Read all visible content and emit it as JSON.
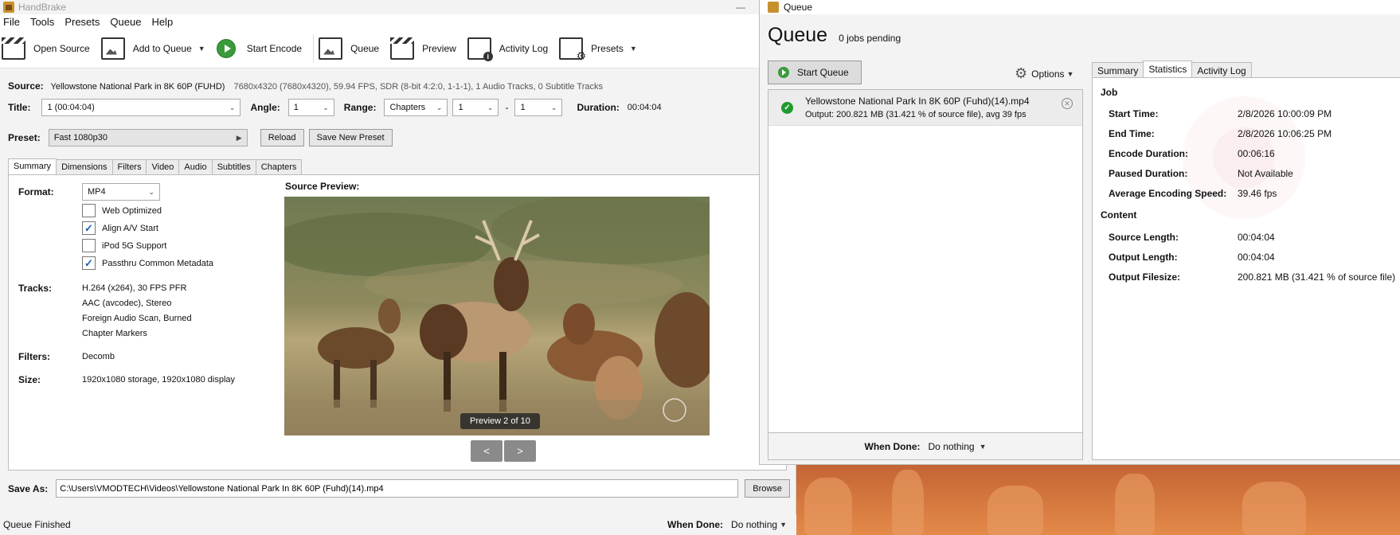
{
  "main": {
    "title": "HandBrake",
    "menu": [
      "File",
      "Tools",
      "Presets",
      "Queue",
      "Help"
    ],
    "toolbar": {
      "open_source": "Open Source",
      "add_to_queue": "Add to Queue",
      "start_encode": "Start Encode",
      "queue": "Queue",
      "preview": "Preview",
      "activity_log": "Activity Log",
      "presets": "Presets"
    },
    "source": {
      "label": "Source:",
      "name": "Yellowstone National Park in 8K 60P (FUHD)",
      "meta": "7680x4320 (7680x4320), 59.94 FPS, SDR (8-bit 4:2:0, 1-1-1), 1 Audio Tracks, 0 Subtitle Tracks"
    },
    "title_row": {
      "title_label": "Title:",
      "title_value": "1 (00:04:04)",
      "angle_label": "Angle:",
      "angle_value": "1",
      "range_label": "Range:",
      "range_type": "Chapters",
      "range_start": "1",
      "range_dash": "-",
      "range_end": "1",
      "duration_label": "Duration:",
      "duration_value": "00:04:04"
    },
    "preset": {
      "label": "Preset:",
      "value": "Fast 1080p30",
      "reload": "Reload",
      "save_new": "Save New Preset"
    },
    "tabs": [
      "Summary",
      "Dimensions",
      "Filters",
      "Video",
      "Audio",
      "Subtitles",
      "Chapters"
    ],
    "summary": {
      "format_label": "Format:",
      "format_value": "MP4",
      "checks": [
        {
          "label": "Web Optimized",
          "checked": false
        },
        {
          "label": "Align A/V Start",
          "checked": true
        },
        {
          "label": "iPod 5G Support",
          "checked": false
        },
        {
          "label": "Passthru Common Metadata",
          "checked": true
        }
      ],
      "tracks_label": "Tracks:",
      "tracks": [
        "H.264 (x264), 30 FPS PFR",
        "AAC (avcodec), Stereo",
        "Foreign Audio Scan, Burned",
        "Chapter Markers"
      ],
      "filters_label": "Filters:",
      "filters_value": "Decomb",
      "size_label": "Size:",
      "size_value": "1920x1080 storage, 1920x1080 display",
      "source_preview_label": "Source Preview:",
      "preview_counter": "Preview 2 of 10",
      "prev_btn": "<",
      "next_btn": ">"
    },
    "save_as": {
      "label": "Save As:",
      "path": "C:\\Users\\VMODTECH\\Videos\\Yellowstone National Park In 8K 60P (Fuhd)(14).mp4",
      "browse": "Browse"
    },
    "status": {
      "text": "Queue Finished",
      "when_done_label": "When Done:",
      "when_done_value": "Do nothing"
    }
  },
  "queue": {
    "window_title": "Queue",
    "heading": "Queue",
    "pending": "0 jobs pending",
    "start_queue": "Start Queue",
    "options": "Options",
    "job": {
      "title": "Yellowstone National Park In 8K 60P (Fuhd)(14).mp4",
      "output": "Output: 200.821 MB (31.421 % of source file), avg 39 fps"
    },
    "when_done_label": "When Done:",
    "when_done_value": "Do nothing",
    "tabs": [
      "Summary",
      "Statistics",
      "Activity Log"
    ],
    "stats": {
      "job_heading": "Job",
      "start_time_label": "Start Time:",
      "start_time": "2/8/2026 10:00:09 PM",
      "end_time_label": "End Time:",
      "end_time": "2/8/2026 10:06:25 PM",
      "encode_duration_label": "Encode Duration:",
      "encode_duration": "00:06:16",
      "paused_duration_label": "Paused Duration:",
      "paused_duration": "Not Available",
      "avg_speed_label": "Average Encoding Speed:",
      "avg_speed": "39.46 fps",
      "content_heading": "Content",
      "source_length_label": "Source Length:",
      "source_length": "00:04:04",
      "output_length_label": "Output Length:",
      "output_length": "00:04:04",
      "output_filesize_label": "Output Filesize:",
      "output_filesize": "200.821 MB (31.421 % of source file)"
    }
  },
  "colors": {
    "accent_green": "#3a9a3a",
    "check_blue": "#1b5fb0",
    "desktop": "#c0572e"
  }
}
